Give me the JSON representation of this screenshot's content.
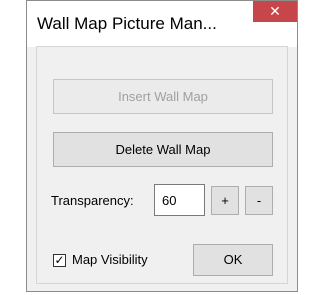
{
  "window": {
    "title": "Wall Map Picture Man...",
    "close_glyph": "✕"
  },
  "buttons": {
    "insert": "Insert Wall Map",
    "delete": "Delete Wall Map",
    "plus": "+",
    "minus": "-",
    "ok": "OK"
  },
  "transparency": {
    "label": "Transparency:",
    "value": "60"
  },
  "visibility": {
    "label": "Map Visibility",
    "checked": true,
    "check_glyph": "✓"
  }
}
